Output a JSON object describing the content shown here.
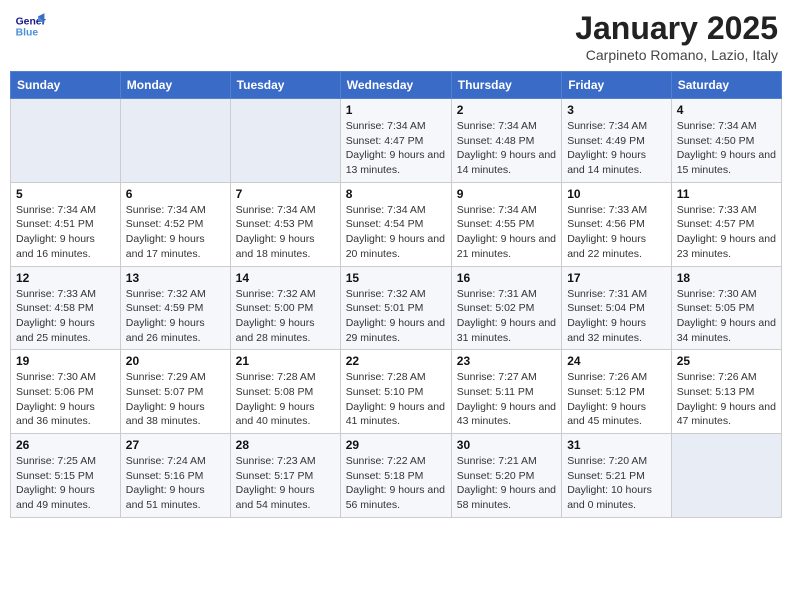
{
  "logo": {
    "line1": "General",
    "line2": "Blue"
  },
  "title": "January 2025",
  "location": "Carpineto Romano, Lazio, Italy",
  "days_header": [
    "Sunday",
    "Monday",
    "Tuesday",
    "Wednesday",
    "Thursday",
    "Friday",
    "Saturday"
  ],
  "weeks": [
    [
      {
        "day": "",
        "sunrise": "",
        "sunset": "",
        "daylight": ""
      },
      {
        "day": "",
        "sunrise": "",
        "sunset": "",
        "daylight": ""
      },
      {
        "day": "",
        "sunrise": "",
        "sunset": "",
        "daylight": ""
      },
      {
        "day": "1",
        "sunrise": "Sunrise: 7:34 AM",
        "sunset": "Sunset: 4:47 PM",
        "daylight": "Daylight: 9 hours and 13 minutes."
      },
      {
        "day": "2",
        "sunrise": "Sunrise: 7:34 AM",
        "sunset": "Sunset: 4:48 PM",
        "daylight": "Daylight: 9 hours and 14 minutes."
      },
      {
        "day": "3",
        "sunrise": "Sunrise: 7:34 AM",
        "sunset": "Sunset: 4:49 PM",
        "daylight": "Daylight: 9 hours and 14 minutes."
      },
      {
        "day": "4",
        "sunrise": "Sunrise: 7:34 AM",
        "sunset": "Sunset: 4:50 PM",
        "daylight": "Daylight: 9 hours and 15 minutes."
      }
    ],
    [
      {
        "day": "5",
        "sunrise": "Sunrise: 7:34 AM",
        "sunset": "Sunset: 4:51 PM",
        "daylight": "Daylight: 9 hours and 16 minutes."
      },
      {
        "day": "6",
        "sunrise": "Sunrise: 7:34 AM",
        "sunset": "Sunset: 4:52 PM",
        "daylight": "Daylight: 9 hours and 17 minutes."
      },
      {
        "day": "7",
        "sunrise": "Sunrise: 7:34 AM",
        "sunset": "Sunset: 4:53 PM",
        "daylight": "Daylight: 9 hours and 18 minutes."
      },
      {
        "day": "8",
        "sunrise": "Sunrise: 7:34 AM",
        "sunset": "Sunset: 4:54 PM",
        "daylight": "Daylight: 9 hours and 20 minutes."
      },
      {
        "day": "9",
        "sunrise": "Sunrise: 7:34 AM",
        "sunset": "Sunset: 4:55 PM",
        "daylight": "Daylight: 9 hours and 21 minutes."
      },
      {
        "day": "10",
        "sunrise": "Sunrise: 7:33 AM",
        "sunset": "Sunset: 4:56 PM",
        "daylight": "Daylight: 9 hours and 22 minutes."
      },
      {
        "day": "11",
        "sunrise": "Sunrise: 7:33 AM",
        "sunset": "Sunset: 4:57 PM",
        "daylight": "Daylight: 9 hours and 23 minutes."
      }
    ],
    [
      {
        "day": "12",
        "sunrise": "Sunrise: 7:33 AM",
        "sunset": "Sunset: 4:58 PM",
        "daylight": "Daylight: 9 hours and 25 minutes."
      },
      {
        "day": "13",
        "sunrise": "Sunrise: 7:32 AM",
        "sunset": "Sunset: 4:59 PM",
        "daylight": "Daylight: 9 hours and 26 minutes."
      },
      {
        "day": "14",
        "sunrise": "Sunrise: 7:32 AM",
        "sunset": "Sunset: 5:00 PM",
        "daylight": "Daylight: 9 hours and 28 minutes."
      },
      {
        "day": "15",
        "sunrise": "Sunrise: 7:32 AM",
        "sunset": "Sunset: 5:01 PM",
        "daylight": "Daylight: 9 hours and 29 minutes."
      },
      {
        "day": "16",
        "sunrise": "Sunrise: 7:31 AM",
        "sunset": "Sunset: 5:02 PM",
        "daylight": "Daylight: 9 hours and 31 minutes."
      },
      {
        "day": "17",
        "sunrise": "Sunrise: 7:31 AM",
        "sunset": "Sunset: 5:04 PM",
        "daylight": "Daylight: 9 hours and 32 minutes."
      },
      {
        "day": "18",
        "sunrise": "Sunrise: 7:30 AM",
        "sunset": "Sunset: 5:05 PM",
        "daylight": "Daylight: 9 hours and 34 minutes."
      }
    ],
    [
      {
        "day": "19",
        "sunrise": "Sunrise: 7:30 AM",
        "sunset": "Sunset: 5:06 PM",
        "daylight": "Daylight: 9 hours and 36 minutes."
      },
      {
        "day": "20",
        "sunrise": "Sunrise: 7:29 AM",
        "sunset": "Sunset: 5:07 PM",
        "daylight": "Daylight: 9 hours and 38 minutes."
      },
      {
        "day": "21",
        "sunrise": "Sunrise: 7:28 AM",
        "sunset": "Sunset: 5:08 PM",
        "daylight": "Daylight: 9 hours and 40 minutes."
      },
      {
        "day": "22",
        "sunrise": "Sunrise: 7:28 AM",
        "sunset": "Sunset: 5:10 PM",
        "daylight": "Daylight: 9 hours and 41 minutes."
      },
      {
        "day": "23",
        "sunrise": "Sunrise: 7:27 AM",
        "sunset": "Sunset: 5:11 PM",
        "daylight": "Daylight: 9 hours and 43 minutes."
      },
      {
        "day": "24",
        "sunrise": "Sunrise: 7:26 AM",
        "sunset": "Sunset: 5:12 PM",
        "daylight": "Daylight: 9 hours and 45 minutes."
      },
      {
        "day": "25",
        "sunrise": "Sunrise: 7:26 AM",
        "sunset": "Sunset: 5:13 PM",
        "daylight": "Daylight: 9 hours and 47 minutes."
      }
    ],
    [
      {
        "day": "26",
        "sunrise": "Sunrise: 7:25 AM",
        "sunset": "Sunset: 5:15 PM",
        "daylight": "Daylight: 9 hours and 49 minutes."
      },
      {
        "day": "27",
        "sunrise": "Sunrise: 7:24 AM",
        "sunset": "Sunset: 5:16 PM",
        "daylight": "Daylight: 9 hours and 51 minutes."
      },
      {
        "day": "28",
        "sunrise": "Sunrise: 7:23 AM",
        "sunset": "Sunset: 5:17 PM",
        "daylight": "Daylight: 9 hours and 54 minutes."
      },
      {
        "day": "29",
        "sunrise": "Sunrise: 7:22 AM",
        "sunset": "Sunset: 5:18 PM",
        "daylight": "Daylight: 9 hours and 56 minutes."
      },
      {
        "day": "30",
        "sunrise": "Sunrise: 7:21 AM",
        "sunset": "Sunset: 5:20 PM",
        "daylight": "Daylight: 9 hours and 58 minutes."
      },
      {
        "day": "31",
        "sunrise": "Sunrise: 7:20 AM",
        "sunset": "Sunset: 5:21 PM",
        "daylight": "Daylight: 10 hours and 0 minutes."
      },
      {
        "day": "",
        "sunrise": "",
        "sunset": "",
        "daylight": ""
      }
    ]
  ]
}
